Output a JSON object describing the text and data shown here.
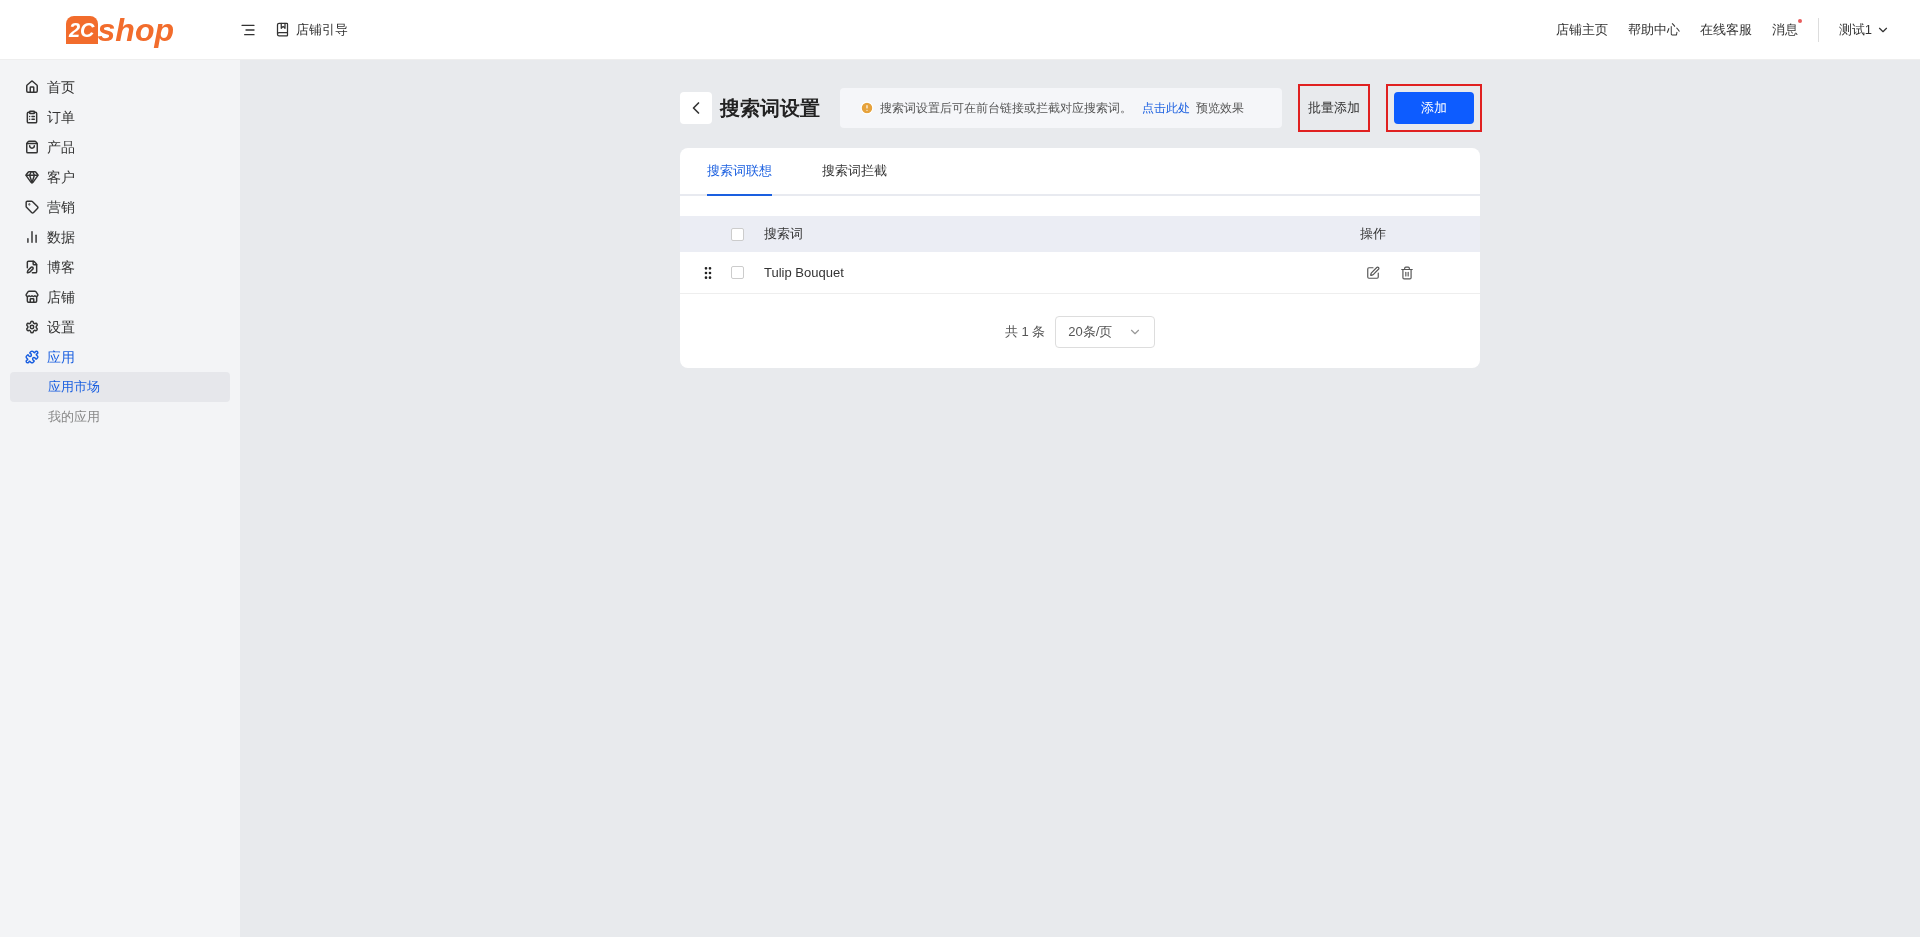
{
  "header": {
    "logo": {
      "mark": "2C",
      "text": "shop"
    },
    "breadcrumb": "店铺引导",
    "links": [
      "店铺主页",
      "帮助中心",
      "在线客服"
    ],
    "messages": {
      "label": "消息",
      "unread": true
    },
    "user": "测试1"
  },
  "sidebar": {
    "items": [
      {
        "label": "首页",
        "selected": false
      },
      {
        "label": "订单",
        "selected": false
      },
      {
        "label": "产品",
        "selected": false
      },
      {
        "label": "客户",
        "selected": false
      },
      {
        "label": "营销",
        "selected": false
      },
      {
        "label": "数据",
        "selected": false
      },
      {
        "label": "博客",
        "selected": false
      },
      {
        "label": "店铺",
        "selected": false
      },
      {
        "label": "设置",
        "selected": false
      },
      {
        "label": "应用",
        "selected": true,
        "children": [
          {
            "label": "应用市场",
            "selected": true
          },
          {
            "label": "我的应用",
            "selected": false
          }
        ]
      }
    ]
  },
  "page": {
    "title": "搜索词设置",
    "notice": "搜索词设置后可在前台链接或拦截对应搜索词。",
    "notice_link": "点击此处",
    "notice_suffix": "预览效果",
    "buttons": [
      {
        "label": "批量添加",
        "kind": "secondary",
        "highlighted": true
      },
      {
        "label": "添加",
        "kind": "primary",
        "highlighted": true
      }
    ]
  },
  "tabs": [
    {
      "label": "搜索词联想",
      "selected": true
    },
    {
      "label": "搜索词拦截",
      "selected": false
    }
  ],
  "table": {
    "columns": [
      "搜索词",
      "操作"
    ],
    "header_checked": false,
    "rows": [
      {
        "term": "Tulip Bouquet",
        "checked": false
      }
    ]
  },
  "pagination": {
    "total": "共 1 条",
    "page_size": "20条/页"
  }
}
